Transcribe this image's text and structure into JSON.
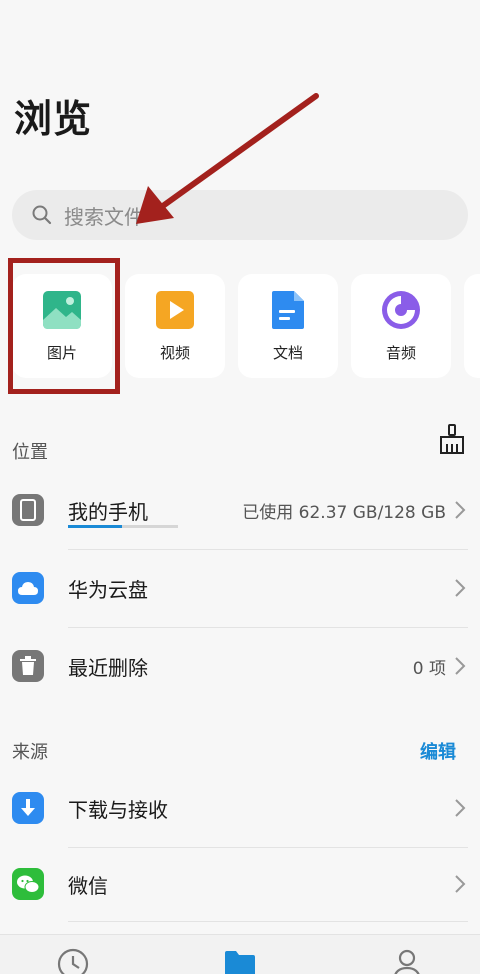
{
  "page": {
    "title": "浏览"
  },
  "search": {
    "placeholder": "搜索文件"
  },
  "categories": [
    {
      "label": "图片",
      "icon": "image-icon",
      "color": "#2fb58a"
    },
    {
      "label": "视频",
      "icon": "video-icon",
      "color": "#f5a623"
    },
    {
      "label": "文档",
      "icon": "document-icon",
      "color": "#2e8bf0"
    },
    {
      "label": "音频",
      "icon": "audio-icon",
      "color": "#8a5de8"
    }
  ],
  "location": {
    "label": "位置",
    "items": [
      {
        "title": "我的手机",
        "value": "已使用 62.37 GB/128 GB",
        "icon": "phone-icon",
        "storage_used_fraction": 0.49
      },
      {
        "title": "华为云盘",
        "value": "",
        "icon": "cloud-icon"
      },
      {
        "title": "最近删除",
        "value": "0 项",
        "icon": "trash-icon"
      }
    ]
  },
  "sources": {
    "label": "来源",
    "edit_label": "编辑",
    "items": [
      {
        "title": "下载与接收",
        "icon": "download-icon"
      },
      {
        "title": "微信",
        "icon": "wechat-icon"
      }
    ]
  },
  "tabs": [
    {
      "icon": "clock-icon"
    },
    {
      "icon": "folder-icon",
      "active": true
    },
    {
      "icon": "person-icon"
    }
  ],
  "colors": {
    "accent": "#1a8ad6",
    "highlight": "#a3211d"
  }
}
